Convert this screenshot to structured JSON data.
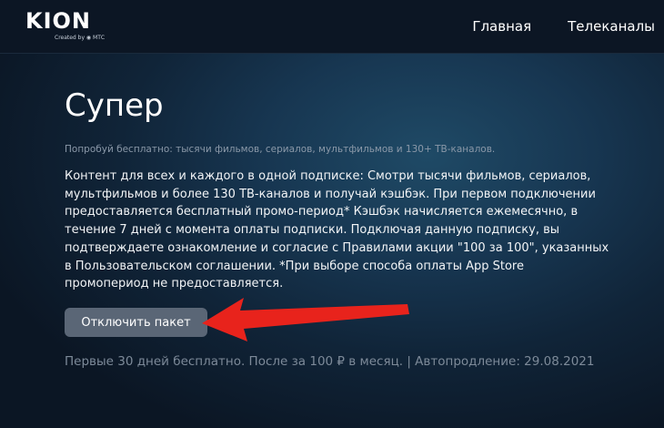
{
  "brand": {
    "name": "KION",
    "tagline": "Created by ◉ МТС"
  },
  "nav": {
    "items": [
      "Главная",
      "Телеканалы"
    ]
  },
  "package": {
    "title": "Супер",
    "subtitle": "Попробуй бесплатно: тысячи фильмов, сериалов, мультфильмов и 130+ ТВ-каналов.",
    "description": "Контент для всех и каждого в одной подписке: Смотри тысячи фильмов, сериалов, мультфильмов и более 130 ТВ-каналов и получай кэшбэк. При первом подключении предоставляется бесплатный промо-период* Кэшбэк начисляется ежемесячно, в течение 7 дней с момента оплаты подписки. Подключая данную подписку, вы подтверждаете ознакомление и согласие с Правилами акции \"100 за 100\", указанных в Пользовательском соглашении. *При выборе способа оплаты App Store промопериод не предоставляется.",
    "disconnect_label": "Отключить пакет",
    "terms": "Первые 30 дней бесплатно. После за 100 ₽ в месяц.  |  Автопродление: 29.08.2021"
  },
  "colors": {
    "arrow": "#e8231c",
    "button": "#5a6676",
    "header": "#0c1624"
  }
}
